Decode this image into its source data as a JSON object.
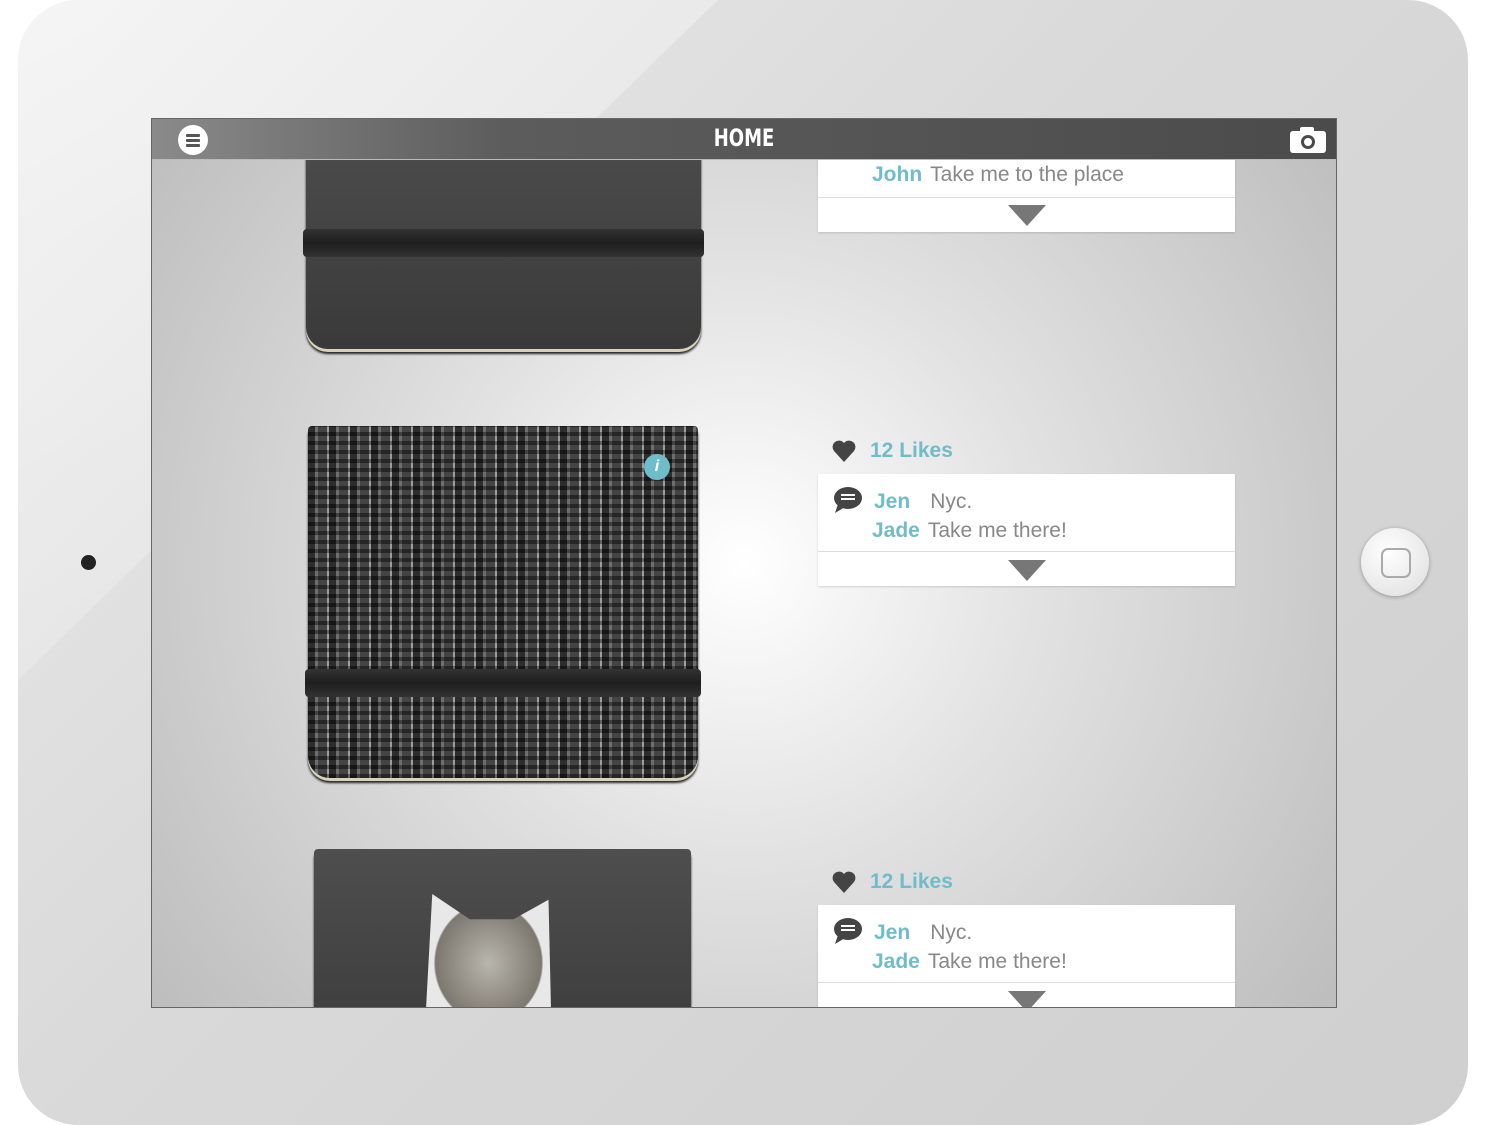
{
  "header": {
    "title": "HOME",
    "menu_icon": "menu-icon",
    "camera_icon": "camera-icon"
  },
  "colors": {
    "accent": "#6fbccb",
    "header": "#4b4b4b"
  },
  "posts": [
    {
      "comments": [
        {
          "name": "John",
          "text": "Take me to the place"
        }
      ]
    },
    {
      "likes": "12 Likes",
      "comments": [
        {
          "name": "Jen",
          "text": "Nyc."
        },
        {
          "name": "Jade",
          "text": "Take me there!"
        }
      ]
    },
    {
      "likes": "12 Likes",
      "comments": [
        {
          "name": "Jen",
          "text": "Nyc."
        },
        {
          "name": "Jade",
          "text": "Take me there!"
        }
      ]
    }
  ]
}
